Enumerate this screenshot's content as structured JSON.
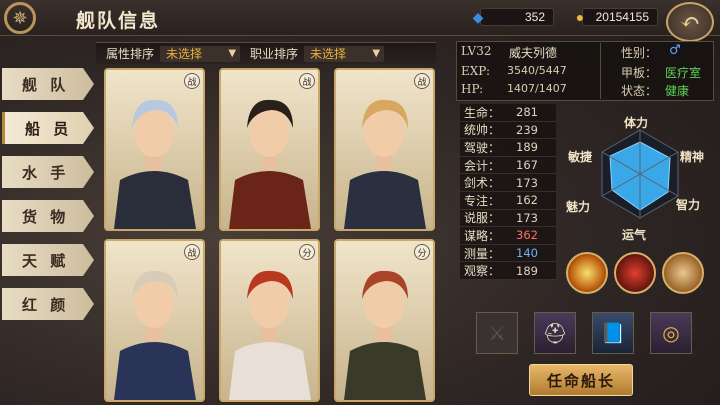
{
  "header": {
    "title": "舰队信息",
    "gems": "352",
    "gold": "20154155"
  },
  "sort": {
    "attr_label": "属性排序",
    "attr_value": "未选择",
    "job_label": "职业排序",
    "job_value": "未选择"
  },
  "tabs": [
    "舰 队",
    "船 员",
    "水 手",
    "货 物",
    "天 赋",
    "红 颜"
  ],
  "cards": [
    {
      "badge": "战",
      "hair": "#b8c8e0",
      "coat": "#2a2e3a"
    },
    {
      "badge": "战",
      "hair": "#2a201a",
      "coat": "#6a2418"
    },
    {
      "badge": "战",
      "hair": "#d8a860",
      "coat": "#2a3040"
    },
    {
      "badge": "战",
      "hair": "#d8ccb8",
      "coat": "#2a3458"
    },
    {
      "badge": "分",
      "hair": "#b83820",
      "coat": "#e8e0d8"
    },
    {
      "badge": "分",
      "hair": "#a84428",
      "coat": "#3a3a2a"
    }
  ],
  "info": {
    "level": "LV32",
    "name": "威夫列德",
    "gender_label": "性别：",
    "gender_value": "♂",
    "exp_label": "EXP:",
    "exp_value": "3540/5447",
    "deck_label": "甲板：",
    "deck_value": "医疗室",
    "hp_label": "HP:",
    "hp_value": "1407/1407",
    "status_label": "状态：",
    "status_value": "健康"
  },
  "stats": [
    {
      "k": "生命：",
      "v": "281",
      "color": ""
    },
    {
      "k": "统帅：",
      "v": "239",
      "color": ""
    },
    {
      "k": "驾驶：",
      "v": "189",
      "color": ""
    },
    {
      "k": "会计：",
      "v": "167",
      "color": ""
    },
    {
      "k": "剑术：",
      "v": "173",
      "color": ""
    },
    {
      "k": "专注：",
      "v": "162",
      "color": ""
    },
    {
      "k": "说服：",
      "v": "173",
      "color": ""
    },
    {
      "k": "谋略：",
      "v": "362",
      "color": "red"
    },
    {
      "k": "测量：",
      "v": "140",
      "color": "blue"
    },
    {
      "k": "观察：",
      "v": "189",
      "color": ""
    }
  ],
  "radar": {
    "labels": [
      "体力",
      "精神",
      "智力",
      "运气",
      "魅力",
      "敏捷"
    ],
    "fill": "#3aa8e8"
  },
  "appoint_label": "任命船长"
}
